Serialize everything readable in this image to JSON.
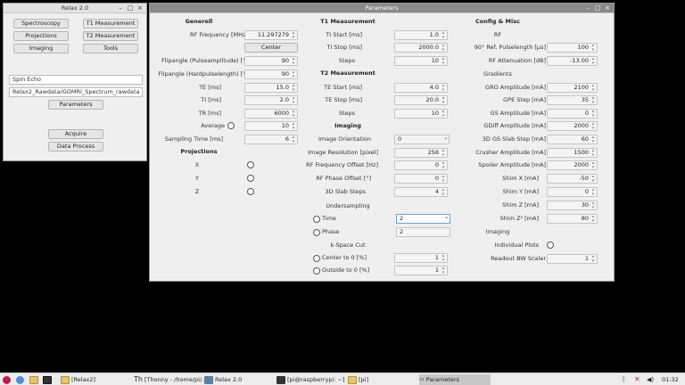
{
  "relax": {
    "title": "Relax 2.0",
    "buttons": [
      "Spectroscopy",
      "T1 Measurement",
      "Projections",
      "T2 Measurement",
      "Imaging",
      "Tools"
    ],
    "sequence_field": "Spin Echo",
    "path_field": "Relax2_Rawdata/GOMRI_Spectrum_rawdata",
    "parameters_button": "Parameters",
    "acquire_button": "Acquire",
    "data_process_button": "Data Process"
  },
  "params": {
    "title": "Parameters",
    "generell": {
      "header": "Generell",
      "rows": [
        {
          "label": "RF Frequency [MHz]",
          "value": "11.297279"
        },
        {
          "label": "Flipangle (Pulseamplitude) [°]",
          "value": "90"
        },
        {
          "label": "Flipangle (Hardpulselength) [°]",
          "value": "90"
        },
        {
          "label": "TE [ms]",
          "value": "15.0"
        },
        {
          "label": "TI [ms]",
          "value": "2.0"
        },
        {
          "label": "TR [ms]",
          "value": "6000"
        },
        {
          "label": "Average",
          "value": "10"
        },
        {
          "label": "Sampling Time [ms]",
          "value": "6"
        }
      ],
      "center_button": "Center",
      "projections_header": "Projections",
      "proj": [
        "X",
        "Y",
        "Z"
      ]
    },
    "t1": {
      "header": "T1 Measurement",
      "rows": [
        {
          "label": "TI Start [ms]",
          "value": "1.0"
        },
        {
          "label": "TI Stop [ms]",
          "value": "2000.0"
        },
        {
          "label": "Steps",
          "value": "10"
        }
      ]
    },
    "t2": {
      "header": "T2 Measurement",
      "rows": [
        {
          "label": "TE Start [ms]",
          "value": "4.0"
        },
        {
          "label": "TE Stop [ms]",
          "value": "20.0"
        },
        {
          "label": "Steps",
          "value": "10"
        }
      ]
    },
    "imaging": {
      "header": "Imaging",
      "orientation_label": "Image Orientation",
      "orientation_value": "0",
      "rows": [
        {
          "label": "Image Resolution [pixel]",
          "value": "256"
        },
        {
          "label": "RF Frequency Offset [Hz]",
          "value": "0"
        },
        {
          "label": "RF Phase Offset [°]",
          "value": "0"
        },
        {
          "label": "3D Slab Steps",
          "value": "4"
        }
      ],
      "undersampling": "Undersampling",
      "time_label": "Time",
      "time_value": "2",
      "phase_label": "Phase",
      "phase_value": "2",
      "kspace": "k-Space Cut",
      "center_to_0": "Center to 0 [%]",
      "center_to_0_value": "1",
      "outside_to_0": "Outside to 0 [%]",
      "outside_to_0_value": "1"
    },
    "config": {
      "header": "Config & Misc",
      "rf_header": "RF",
      "rf_rows": [
        {
          "label": "90° Ref. Pulselength [µs]",
          "value": "100"
        },
        {
          "label": "RF Attenuation [dB]",
          "value": "-13.00"
        }
      ],
      "gradients_header": "Gradients",
      "grad_rows": [
        {
          "label": "GRO Amplitude [mA]",
          "value": "2100"
        },
        {
          "label": "GPE Step [mA]",
          "value": "35"
        },
        {
          "label": "GS Amplitude [mA]",
          "value": "0"
        },
        {
          "label": "GDiff Amplitude [mA]",
          "value": "2000"
        },
        {
          "label": "3D GS Slab Step [mA]",
          "value": "60"
        },
        {
          "label": "Crusher Amplitude [mA]",
          "value": "1500"
        },
        {
          "label": "Spoiler Amplitude [mA]",
          "value": "2000"
        },
        {
          "label": "Shim X [mA]",
          "value": "-50"
        },
        {
          "label": "Shim Y [mA]",
          "value": "0"
        },
        {
          "label": "Shim Z [mA]",
          "value": "30"
        },
        {
          "label": "Shim Z² [mA]",
          "value": "80"
        }
      ],
      "imaging_header": "Imaging",
      "individual_plots": "Individual Plots",
      "readout_label": "Readout BW Scaler",
      "readout_value": "1"
    }
  },
  "taskbar": {
    "items": [
      "[Relax2]",
      "[Thonny - /home/pi/...",
      "Relax 2.0",
      "[pi@raspberrypi: ~]",
      "[pi]",
      "Parameters"
    ],
    "clock": "01:32"
  }
}
